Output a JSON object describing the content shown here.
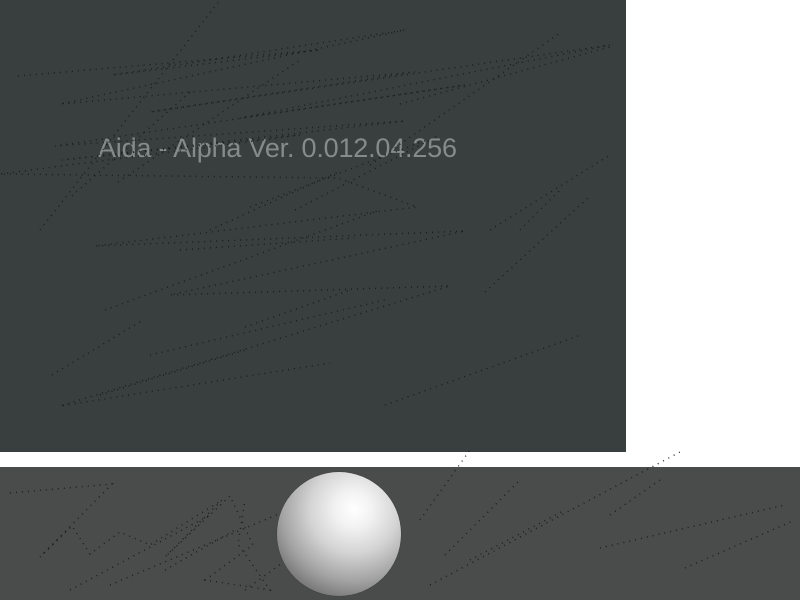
{
  "app": {
    "title": "Aida - Alpha Ver. 0.012.04.256"
  },
  "colors": {
    "top_panel": "#393f3e",
    "bottom_panel": "#4a4b4b",
    "title_text": "#858b8a",
    "scribble": "#151818",
    "page_background": "#ffffff"
  },
  "objects": {
    "sphere_icon": "white-sphere"
  }
}
